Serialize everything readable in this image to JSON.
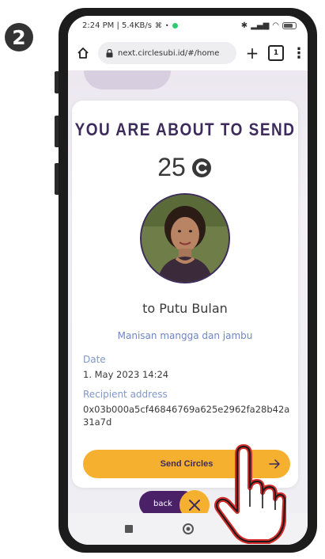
{
  "step": {
    "number": "2"
  },
  "status_bar": {
    "time_info": "2:24 PM | 5.4KB/s",
    "right_icons": "bluetooth, signal, wifi, battery"
  },
  "browser": {
    "url": "next.circlesubi.id/#/home",
    "tab_count": "1",
    "new_tab": "+",
    "menu": "⋮"
  },
  "transfer": {
    "title": "YOU ARE ABOUT TO SEND",
    "amount": "25",
    "currency_icon": "circles-logo-icon",
    "recipient_line": "to Putu Bulan",
    "memo": "Manisan mangga dan jambu",
    "date_label": "Date",
    "date_value": "1. May 2023 14:24",
    "address_label": "Recipient address",
    "address_value": "0x03b000a5cf46846769a625e2962fa28b42a31a7d",
    "send_button": "Send Circles"
  },
  "nav": {
    "back_label": "back"
  },
  "colors": {
    "accent_yellow": "#f6b02f",
    "primary_purple": "#3d2b5c",
    "label_blue": "#7f97c9",
    "back_purple": "#4a2166"
  }
}
